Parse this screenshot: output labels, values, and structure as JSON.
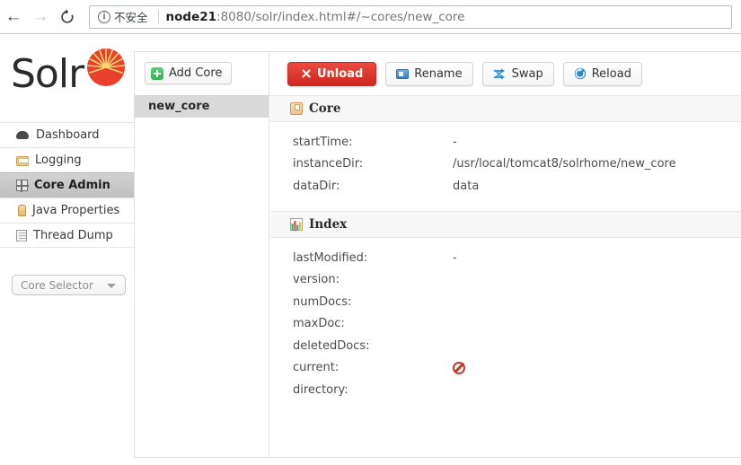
{
  "browser": {
    "back_icon": "back-arrow-icon",
    "forward_icon": "forward-arrow-icon",
    "reload_icon": "reload-icon",
    "info_glyph": "i",
    "security_label": "不安全",
    "url_host": "node21",
    "url_rest": ":8080/solr/index.html#/~cores/new_core"
  },
  "sidebar": {
    "logo_text": "Solr",
    "items": [
      {
        "label": "Dashboard",
        "icon": "dashboard-icon",
        "active": false
      },
      {
        "label": "Logging",
        "icon": "logging-icon",
        "active": false
      },
      {
        "label": "Core Admin",
        "icon": "core-admin-icon",
        "active": true
      },
      {
        "label": "Java Properties",
        "icon": "java-properties-icon",
        "active": false
      },
      {
        "label": "Thread Dump",
        "icon": "thread-dump-icon",
        "active": false
      }
    ],
    "core_selector": {
      "label": "Core Selector",
      "chevron_icon": "chevron-down-icon"
    }
  },
  "core_list": {
    "add_core_label": "Add Core",
    "add_core_icon": "plus-icon",
    "items": [
      {
        "label": "new_core",
        "selected": true
      }
    ]
  },
  "toolbar": {
    "unload_label": "Unload",
    "unload_icon": "x-icon",
    "rename_label": "Rename",
    "rename_icon": "rename-icon",
    "swap_label": "Swap",
    "swap_icon": "swap-icon",
    "reload_label": "Reload",
    "reload_icon": "reload-circular-icon"
  },
  "sections": {
    "core": {
      "title": "Core",
      "icon": "core-box-icon",
      "rows": [
        {
          "key": "startTime:",
          "value": "-"
        },
        {
          "key": "instanceDir:",
          "value": "/usr/local/tomcat8/solrhome/new_core"
        },
        {
          "key": "dataDir:",
          "value": "data"
        }
      ]
    },
    "index": {
      "title": "Index",
      "icon": "index-chart-icon",
      "rows": [
        {
          "key": "lastModified:",
          "value": "-"
        },
        {
          "key": "version:",
          "value": ""
        },
        {
          "key": "numDocs:",
          "value": ""
        },
        {
          "key": "maxDoc:",
          "value": ""
        },
        {
          "key": "deletedDocs:",
          "value": ""
        },
        {
          "key": "current:",
          "value": "",
          "icon": "blocked-icon"
        },
        {
          "key": "directory:",
          "value": ""
        }
      ]
    }
  },
  "colors": {
    "accent_red": "#cf271d",
    "solr_orange": "#d9411e",
    "active_nav": "#c6c6c6",
    "selected_core": "#d9d9d9"
  }
}
